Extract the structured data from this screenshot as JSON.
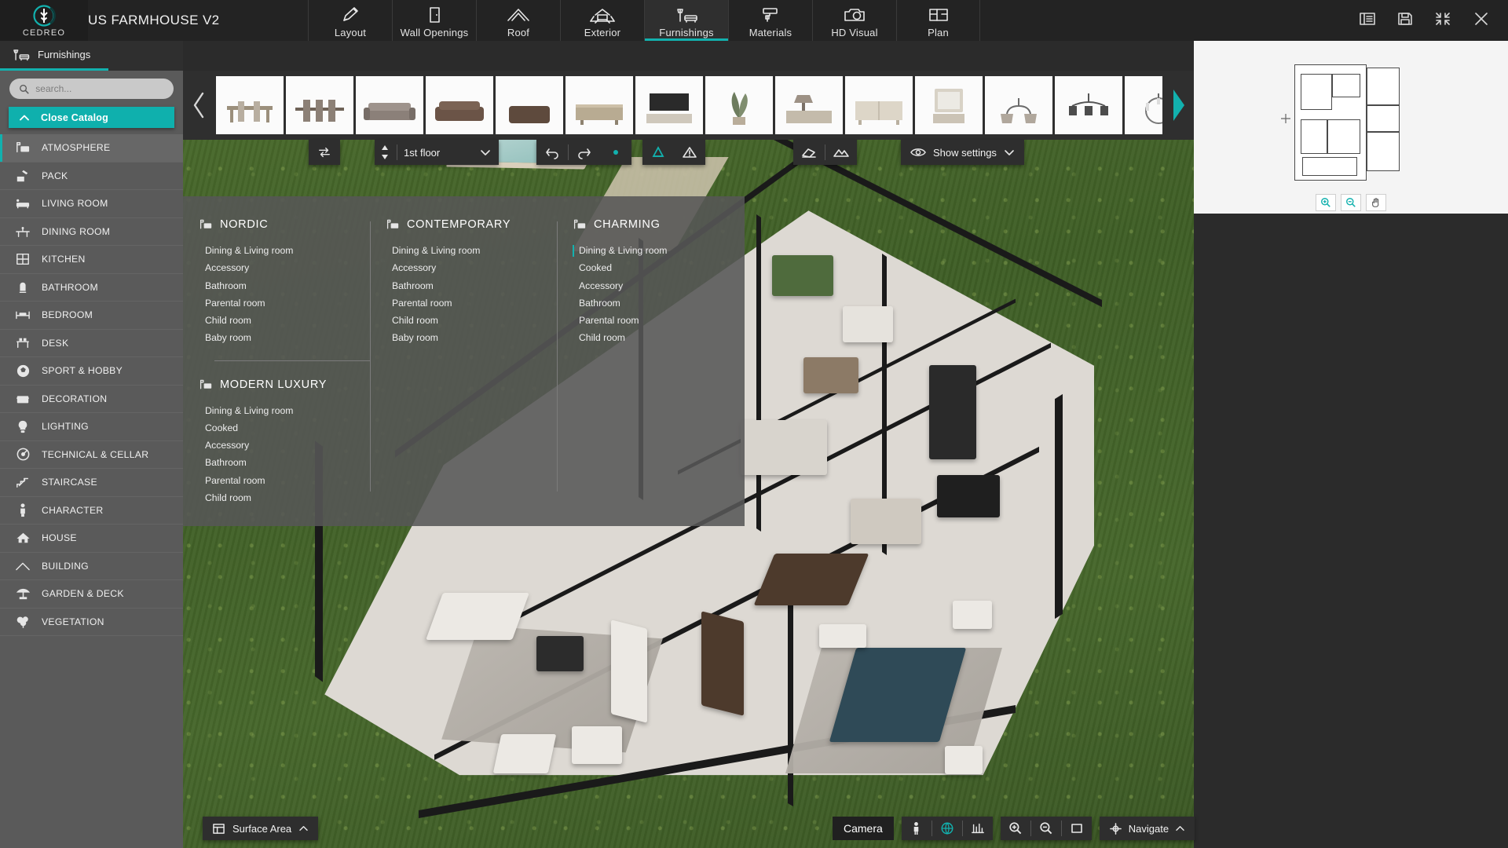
{
  "app": {
    "brand": "CEDREO",
    "project_title": "US FARMHOUSE V2"
  },
  "topnav": {
    "tabs": [
      {
        "label": "Layout",
        "icon": "pencil-icon"
      },
      {
        "label": "Wall Openings",
        "icon": "door-icon"
      },
      {
        "label": "Roof",
        "icon": "roof-icon"
      },
      {
        "label": "Exterior",
        "icon": "house-exterior-icon"
      },
      {
        "label": "Furnishings",
        "icon": "furniture-icon",
        "active": true
      },
      {
        "label": "Materials",
        "icon": "paint-roller-icon"
      },
      {
        "label": "HD Visual",
        "icon": "camera-icon"
      },
      {
        "label": "Plan",
        "icon": "plan-icon"
      }
    ],
    "right_icons": [
      {
        "name": "list-panel-icon"
      },
      {
        "name": "save-icon"
      },
      {
        "name": "collapse-icon"
      },
      {
        "name": "close-icon"
      }
    ]
  },
  "catalog": {
    "tab_label": "Furnishings",
    "tab_icon": "furniture-icon",
    "search": {
      "placeholder": "search...",
      "value": ""
    },
    "close_label": "Close Catalog",
    "accent_color": "#0fb0ad",
    "items": [
      {
        "label": "ATMOSPHERE",
        "icon": "atmosphere-icon",
        "active": true
      },
      {
        "label": "PACK",
        "icon": "pack-icon"
      },
      {
        "label": "LIVING ROOM",
        "icon": "sofa-icon"
      },
      {
        "label": "DINING ROOM",
        "icon": "dining-table-icon"
      },
      {
        "label": "KITCHEN",
        "icon": "kitchen-icon"
      },
      {
        "label": "BATHROOM",
        "icon": "shower-icon"
      },
      {
        "label": "BEDROOM",
        "icon": "bed-icon"
      },
      {
        "label": "DESK",
        "icon": "desk-icon"
      },
      {
        "label": "SPORT & HOBBY",
        "icon": "soccer-ball-icon"
      },
      {
        "label": "DECORATION",
        "icon": "picture-frame-icon"
      },
      {
        "label": "LIGHTING",
        "icon": "lightbulb-icon"
      },
      {
        "label": "TECHNICAL & CELLAR",
        "icon": "gauge-icon"
      },
      {
        "label": "STAIRCASE",
        "icon": "stairs-icon"
      },
      {
        "label": "CHARACTER",
        "icon": "person-icon"
      },
      {
        "label": "HOUSE",
        "icon": "home-icon"
      },
      {
        "label": "BUILDING",
        "icon": "building-icon"
      },
      {
        "label": "GARDEN & DECK",
        "icon": "parasol-icon"
      },
      {
        "label": "VEGETATION",
        "icon": "tree-icon"
      }
    ]
  },
  "thumbstrip": {
    "prev_icon": "chevron-left-icon",
    "next_icon": "chevron-right-icon",
    "thumbs": [
      {
        "name": "dining-set-thumb"
      },
      {
        "name": "dining-table-chairs-thumb"
      },
      {
        "name": "grey-sofa-thumb"
      },
      {
        "name": "brown-sofa-thumb"
      },
      {
        "name": "brown-ottoman-thumb"
      },
      {
        "name": "rustic-console-thumb"
      },
      {
        "name": "tv-unit-thumb"
      },
      {
        "name": "plant-decor-thumb"
      },
      {
        "name": "lamp-sideboard-thumb"
      },
      {
        "name": "white-sideboard-thumb"
      },
      {
        "name": "mirror-cabinet-thumb"
      },
      {
        "name": "two-arm-sconce-thumb"
      },
      {
        "name": "chandelier-dark-thumb"
      },
      {
        "name": "chandelier-candle-thumb"
      },
      {
        "name": "floor-lamp-thumb"
      }
    ]
  },
  "viewbar": {
    "swap_icon": "swap-icon",
    "floor_stepper_icon": "up-down-arrows-icon",
    "floor_value": "1st floor",
    "floor_caret": "chevron-down-icon",
    "undo_icon": "undo-icon",
    "redo_icon": "redo-icon",
    "pin_icon": "pin-dot-icon",
    "measure_icon": "measure-icon",
    "warning_icon": "warning-icon",
    "eraser_icon": "eraser-icon",
    "terrain_icon": "terrain-icon",
    "show_settings_label": "Show settings",
    "show_settings_icon": "eye-icon",
    "show_settings_caret": "chevron-down-icon"
  },
  "megamenu": {
    "columns": [
      {
        "title": "NORDIC",
        "icon": "atmosphere-icon",
        "links": [
          "Dining & Living room",
          "Accessory",
          "Bathroom",
          "Parental room",
          "Child room",
          "Baby room"
        ]
      },
      {
        "title": "CONTEMPORARY",
        "icon": "atmosphere-icon",
        "links": [
          "Dining & Living room",
          "Accessory",
          "Bathroom",
          "Parental room",
          "Child room",
          "Baby room"
        ]
      },
      {
        "title": "CHARMING",
        "icon": "atmosphere-icon",
        "links": [
          "Dining & Living room",
          "Cooked",
          "Accessory",
          "Bathroom",
          "Parental room",
          "Child room"
        ],
        "selected_index": 0
      }
    ],
    "second_row": [
      {
        "title": "MODERN LUXURY",
        "icon": "atmosphere-icon",
        "links": [
          "Dining & Living room",
          "Cooked",
          "Accessory",
          "Bathroom",
          "Parental room",
          "Child room"
        ]
      }
    ]
  },
  "minimap": {
    "zoom_in_icon": "zoom-in-icon",
    "zoom_out_icon": "zoom-out-icon",
    "pan_icon": "pan-hand-icon"
  },
  "bottombar": {
    "surface_area_label": "Surface Area",
    "surface_area_icon": "surface-icon",
    "surface_caret": "chevron-up-icon",
    "camera_label": "Camera",
    "person_icon": "person-view-icon",
    "globe-icon": "globe-icon",
    "layers_icon": "layers-icon",
    "zoom_in_icon": "zoom-in-icon",
    "zoom_out_icon": "zoom-out-icon",
    "navigate_label": "Navigate",
    "navigate_icon": "navigate-icon",
    "navigate_caret": "chevron-up-icon"
  },
  "colors": {
    "accent": "#12b1ae",
    "topbar_bg": "#232323",
    "sidebar_bg": "#5a5a5a",
    "panel_bg": "#2f2f2f"
  }
}
